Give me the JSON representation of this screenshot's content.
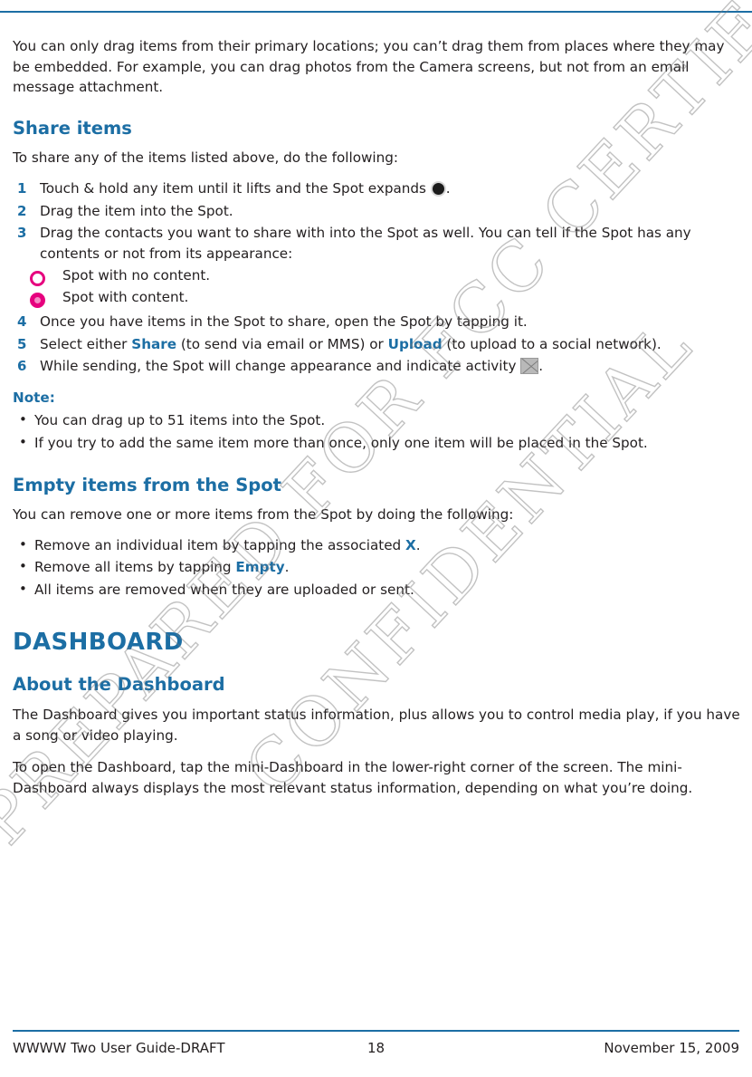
{
  "document": {
    "intro_paragraph": "You can only drag items from their primary locations; you can’t drag them from places where they may be embedded. For example, you can drag photos from the Camera screens, but not from an email message attachment.",
    "share_heading": "Share items",
    "share_intro": "To share any of the items listed above, do the following:",
    "steps": [
      {
        "num": "1",
        "text_before": "Touch & hold any item until it lifts and the Spot expands ",
        "icon": "dark-spot-icon",
        "text_after": "."
      },
      {
        "num": "2",
        "text_before": "Drag the item into the Spot.",
        "text_after": ""
      },
      {
        "num": "3",
        "text_before": "Drag the contacts you want to share with into the Spot as well. You can tell if the Spot has any contents or not from its appearance:",
        "text_after": ""
      },
      {
        "num": "4",
        "text_before": "Once you have items in the Spot to share, open the Spot by tapping it.",
        "text_after": ""
      },
      {
        "num": "5",
        "text_before": "Select either ",
        "keyword1": "Share",
        "text_mid1": " (to send via email or MMS) or ",
        "keyword2": "Upload",
        "text_after": " (to upload to a social network)."
      },
      {
        "num": "6",
        "text_before": "While sending, the Spot will change appearance and indicate activity ",
        "icon": "activity-spot-icon",
        "text_after": "."
      }
    ],
    "spot_legend": [
      {
        "icon": "empty-spot-icon",
        "label": "Spot with no content."
      },
      {
        "icon": "full-spot-icon",
        "label": "Spot with content."
      }
    ],
    "note_label": "Note:",
    "note_bullets": [
      "You can drag up to 51 items into the Spot.",
      "If you try to add the same item more than once, only one item will be placed in the Spot."
    ],
    "empty_heading": "Empty items from the Spot",
    "empty_intro": "You can remove one or more items from the Spot by doing the following:",
    "empty_bullets": [
      {
        "before": "Remove an individual item by tapping the associated ",
        "keyword": "X",
        "after": "."
      },
      {
        "before": "Remove all items by tapping ",
        "keyword": "Empty",
        "after": "."
      },
      {
        "before": "All items are removed when they are uploaded or sent.",
        "keyword": "",
        "after": ""
      }
    ],
    "chapter_title": "DASHBOARD",
    "about_heading": "About the Dashboard",
    "about_paragraph_1": "The Dashboard gives you important status information, plus allows you to control media play, if you have a song or video playing.",
    "about_paragraph_2": "To open the Dashboard, tap the mini-Dashboard in the lower-right corner of the screen. The mini-Dashboard always displays the most relevant status information, depending on what you’re doing."
  },
  "footer": {
    "left": "WWWW Two User Guide-DRAFT",
    "page_number": "18",
    "right": "November 15, 2009"
  },
  "watermark": {
    "line1": "PREPARED FOR FCC CERTIFICATION",
    "line2": "CONFIDENTIAL"
  },
  "colors": {
    "accent": "#1c6ea4",
    "spot_pink": "#e6007e",
    "text": "#231f20"
  }
}
